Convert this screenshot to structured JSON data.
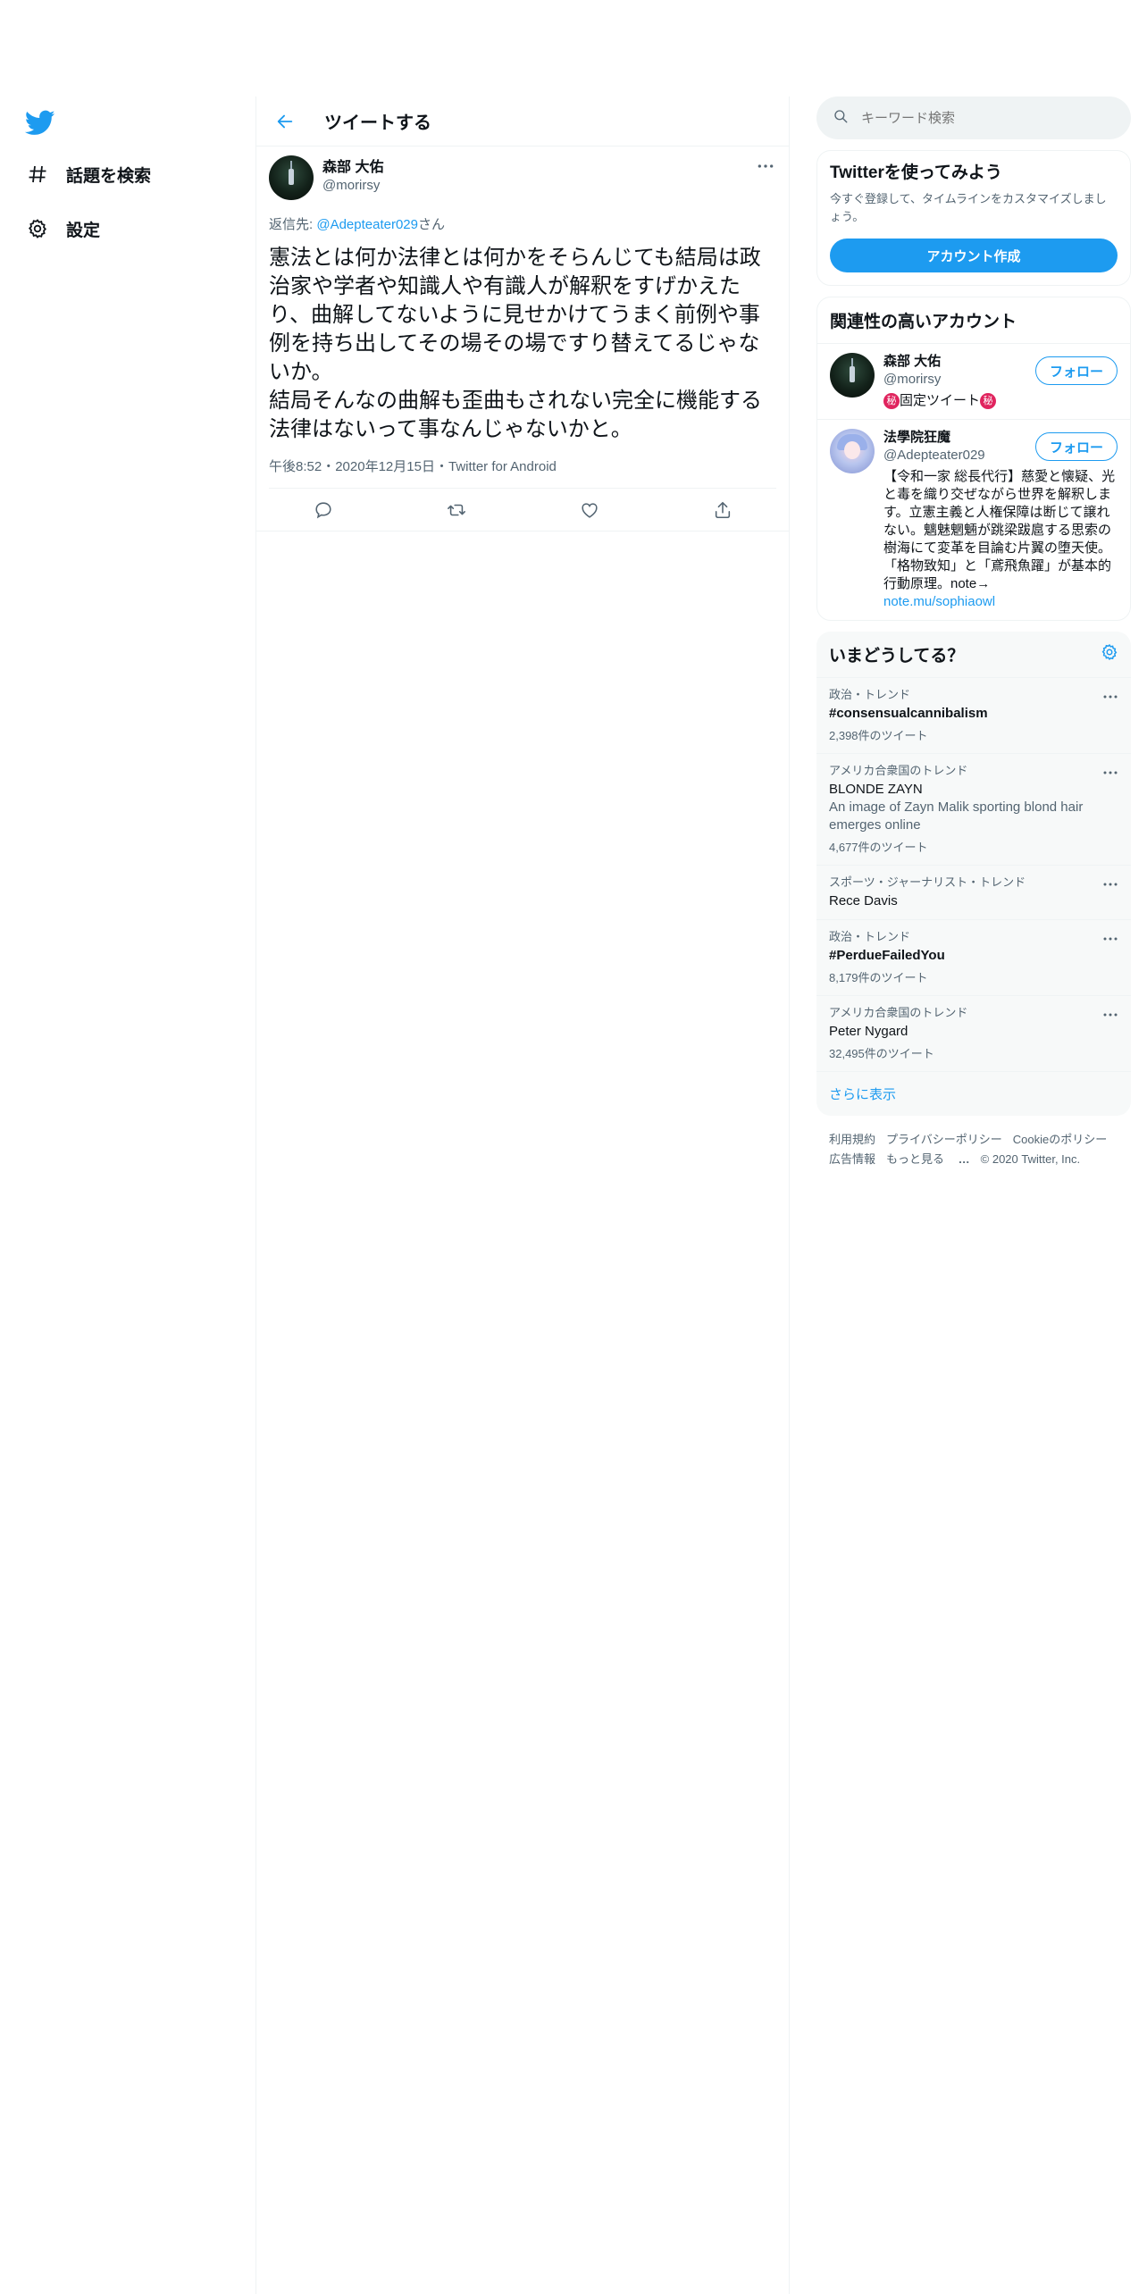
{
  "nav": {
    "explore_label": "話題を検索",
    "settings_label": "設定"
  },
  "header": {
    "title": "ツイートする"
  },
  "tweet": {
    "display_name": "森部 大佑",
    "handle": "@morirsy",
    "reply_prefix": "返信先: ",
    "reply_handle": "@Adepteater029",
    "reply_suffix": "さん",
    "text": "憲法とは何か法律とは何かをそらんじても結局は政治家や学者や知識人や有識人が解釈をすげかえたり、曲解してないように見せかけてうまく前例や事例を持ち出してその場その場ですり替えてるじゃないか。\n結局そんなの曲解も歪曲もされない完全に機能する法律はないって事なんじゃないかと。",
    "time": "午後8:52",
    "date": "2020年12月15日",
    "source": "Twitter for Android",
    "separator": "・"
  },
  "search": {
    "placeholder": "キーワード検索"
  },
  "signup": {
    "title": "Twitterを使ってみよう",
    "subtitle": "今すぐ登録して、タイムラインをカスタマイズしましょう。",
    "button": "アカウント作成"
  },
  "related": {
    "title": "関連性の高いアカウント",
    "follow_label": "フォロー",
    "accounts": [
      {
        "name": "森部 大佑",
        "handle": "@morirsy",
        "bio_badge": "秘",
        "bio": "固定ツイート"
      },
      {
        "name": "法學院狂魔",
        "handle": "@Adepteater029",
        "bio": "【令和一家 総長代行】慈愛と懐疑、光と毒を織り交ぜながら世界を解釈します。立憲主義と人権保障は断じて譲れない。魑魅魍魎が跳梁跋扈する思索の樹海にて変革を目論む片翼の堕天使。「格物致知」と「鳶飛魚躍」が基本的行動原理。note→",
        "bio_link": "note.mu/sophiaowl"
      }
    ]
  },
  "trends": {
    "title": "いまどうしてる？",
    "items": [
      {
        "context": "政治・トレンド",
        "name": "#consensualcannibalism",
        "bold": true,
        "desc": "",
        "count": "2,398件のツイート"
      },
      {
        "context": "アメリカ合衆国のトレンド",
        "name": "BLONDE ZAYN",
        "bold": false,
        "desc": "An image of Zayn Malik sporting blond hair emerges online",
        "count": "4,677件のツイート"
      },
      {
        "context": "スポーツ・ジャーナリスト・トレンド",
        "name": "Rece Davis",
        "bold": false,
        "desc": "",
        "count": ""
      },
      {
        "context": "政治・トレンド",
        "name": "#PerdueFailedYou",
        "bold": true,
        "desc": "",
        "count": "8,179件のツイート"
      },
      {
        "context": "アメリカ合衆国のトレンド",
        "name": "Peter Nygard",
        "bold": false,
        "desc": "",
        "count": "32,495件のツイート"
      }
    ],
    "show_more": "さらに表示"
  },
  "footer": {
    "terms": "利用規約",
    "privacy": "プライバシーポリシー",
    "cookie": "Cookieのポリシー",
    "ads": "広告情報",
    "more": "もっと見る",
    "copyright": "© 2020 Twitter, Inc."
  },
  "colors": {
    "accent": "#1d9bf0",
    "text": "#0f1419",
    "secondary": "#536471",
    "border": "#eff3f4",
    "badge": "#e0245e"
  }
}
